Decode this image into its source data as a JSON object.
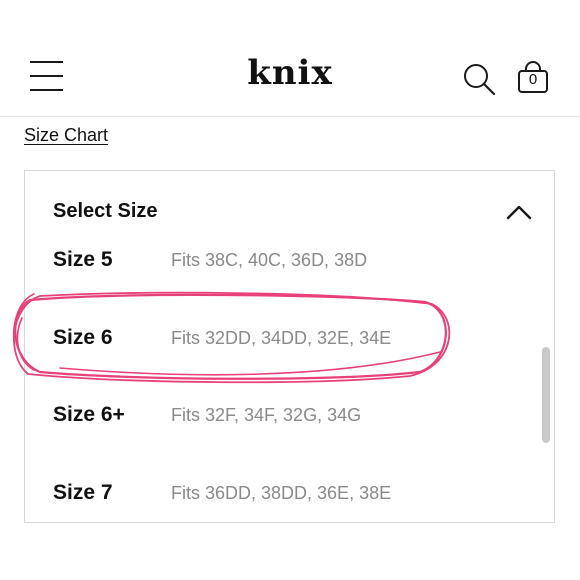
{
  "header": {
    "logo_text": "knix",
    "menu_icon": "hamburger-menu-icon",
    "search_icon": "search-icon",
    "bag_icon": "shopping-bag-icon",
    "bag_count": "0"
  },
  "size_chart_link": "Size Chart",
  "size_selector": {
    "title": "Select Size",
    "expanded": true,
    "options": [
      {
        "name": "Size 5",
        "fits": "Fits 38C, 40C, 36D, 38D"
      },
      {
        "name": "Size 6",
        "fits": "Fits 32DD, 34DD, 32E, 34E",
        "highlighted": true
      },
      {
        "name": "Size 6+",
        "fits": "Fits 32F, 34F, 32G, 34G"
      },
      {
        "name": "Size 7",
        "fits": "Fits 36DD, 38DD, 36E, 38E"
      }
    ]
  },
  "colors": {
    "annotation": "#e8407a",
    "text_primary": "#111111",
    "text_secondary": "#8a8a8a",
    "border": "#d9d9d9"
  }
}
